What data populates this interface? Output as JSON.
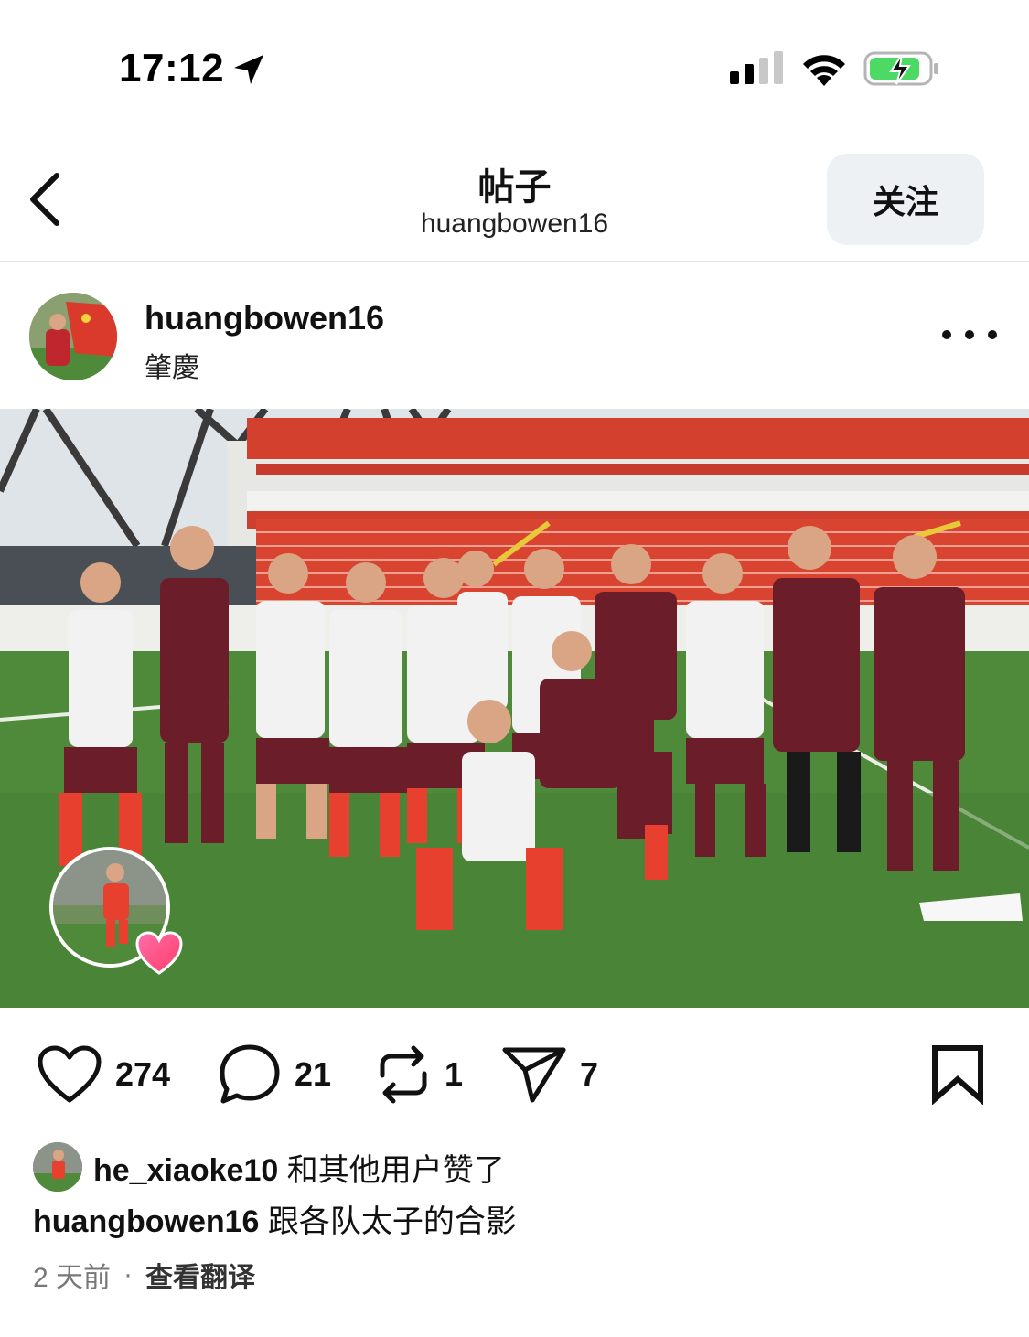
{
  "status": {
    "time": "17:12"
  },
  "nav": {
    "title": "帖子",
    "subtitle": "huangbowen16",
    "follow_label": "关注"
  },
  "post": {
    "author": "huangbowen16",
    "location": "肇慶",
    "likes_count": "274",
    "comments_count": "21",
    "reposts_count": "1",
    "shares_count": "7",
    "liked_by_user": "he_xiaoke10",
    "liked_by_suffix": " 和其他用户赞了",
    "caption_user": "huangbowen16",
    "caption_text": " 跟各队太子的合影",
    "time_ago": "2 天前",
    "translate_label": "查看翻译"
  },
  "colors": {
    "accent_red": "#d93a2b",
    "jersey": "#6b1e2a",
    "pitch": "#4f8a3a",
    "battery": "#4cd964"
  }
}
